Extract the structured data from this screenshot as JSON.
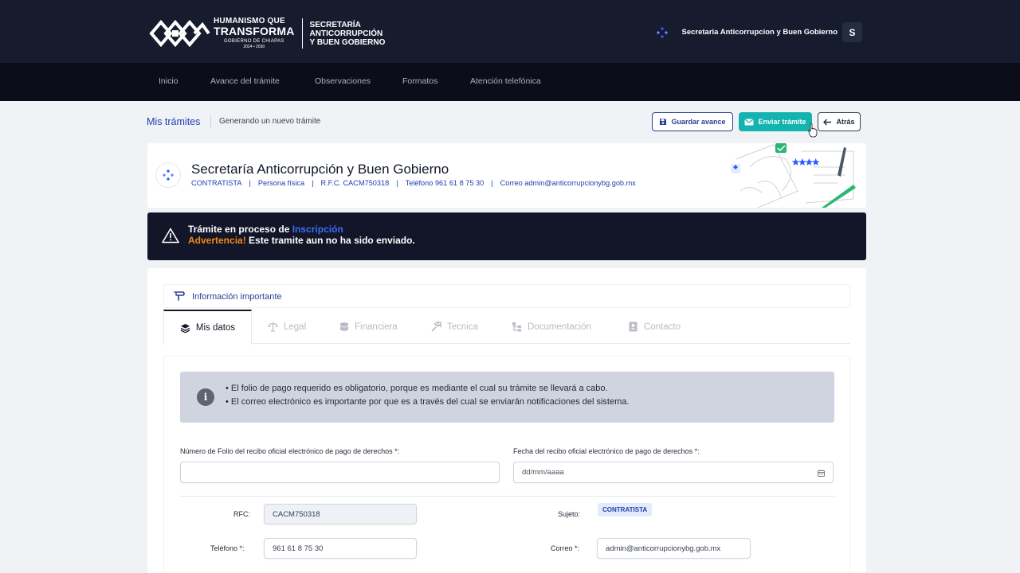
{
  "header": {
    "logo": {
      "line1": "HUMANISMO QUE",
      "line2": "TRANSFORMA",
      "line3": "GOBIERNO DE CHIAPAS",
      "line4": "2024 • 2030",
      "org_line1": "SECRETARÍA",
      "org_line2": "ANTICORRUPCIÓN",
      "org_line3": "Y BUEN GOBIERNO"
    },
    "user_name": "Secretaria Anticorrupcion y Buen Gobierno",
    "user_initial": "S"
  },
  "nav": {
    "items": [
      "Inicio",
      "Avance del trámite",
      "Observaciones",
      "Formatos",
      "Atención telefónica"
    ]
  },
  "breadcrumb": {
    "main": "Mis trámites",
    "sub": "Generando un nuevo trámite"
  },
  "actions": {
    "save_label": "Guardar avance",
    "send_label": "Enviar trámite",
    "back_label": "Atrás"
  },
  "entity": {
    "title": "Secretaría Anticorrupción y Buen Gobierno",
    "meta": [
      "CONTRATISTA",
      "Persona física",
      "R.F.C. CACM750318",
      "Teléfono 961 61 8 75 30",
      "Correo admin@anticorrupcionybg.gob.mx"
    ]
  },
  "alert": {
    "line1_prefix": "Trámite en proceso de ",
    "line1_highlight": "Inscripción",
    "line2_warning": "Advertencia!",
    "line2_text": " Este tramite aun no ha sido enviado."
  },
  "info_link": "Información importante",
  "tabs": [
    {
      "label": "Mis datos",
      "icon": "layers-icon",
      "active": true
    },
    {
      "label": "Legal",
      "icon": "scale-icon",
      "active": false
    },
    {
      "label": "Financiera",
      "icon": "coins-icon",
      "active": false
    },
    {
      "label": "Tecnica",
      "icon": "tools-icon",
      "active": false
    },
    {
      "label": "Documentación",
      "icon": "sitemap-icon",
      "active": false
    },
    {
      "label": "Contacto",
      "icon": "contact-icon",
      "active": false
    }
  ],
  "notice": {
    "line1": "• El folio de pago requerido es obligatorio, porque es mediante el cual su trámite se llevará a cabo.",
    "line2": "• El correo electrónico es importante por que es a través del cual se enviarán notificaciones del sistema."
  },
  "form": {
    "folio_label": "Número de Folio del recibo oficial electrónico de pago de derechos *:",
    "folio_value": "",
    "fecha_label": "Fecha del recibo oficial electrónico de pago de derechos *:",
    "fecha_placeholder": "dd/mm/aaaa",
    "rfc_label": "RFC:",
    "rfc_value": "CACM750318",
    "sujeto_label": "Sujeto:",
    "sujeto_value": "CONTRATISTA",
    "telefono_label": "Teléfono *:",
    "telefono_value": "961 61 8 75 30",
    "correo_label": "Correo *:",
    "correo_value": "admin@anticorrupcionybg.gob.mx"
  },
  "colors": {
    "header_bg": "#161b2e",
    "nav_bg": "#0b0e1a",
    "accent_blue": "#1e40af",
    "send_button": "#13b3b0",
    "warning_orange": "#f28a14"
  }
}
